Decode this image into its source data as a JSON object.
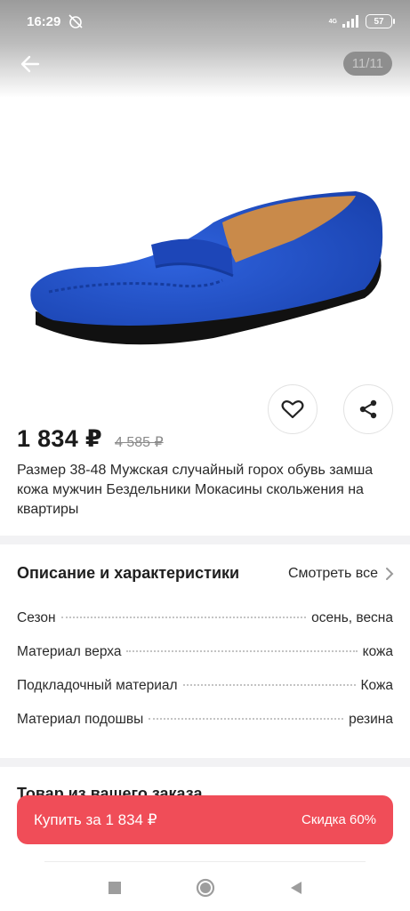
{
  "status_bar": {
    "time": "16:29",
    "network": "4G",
    "battery": "57"
  },
  "gallery": {
    "counter": "11/11"
  },
  "product": {
    "price": "1 834 ₽",
    "old_price": "4 585 ₽",
    "title": "Размер 38-48 Мужская случайный горох обувь замша кожа мужчин Бездельники Мокасины скольжения на квартиры"
  },
  "description": {
    "title": "Описание и характеристики",
    "see_all": "Смотреть все",
    "specs": [
      {
        "label": "Сезон",
        "value": "осень, весна"
      },
      {
        "label": "Материал верха",
        "value": "кожа"
      },
      {
        "label": "Подкладочный материал",
        "value": "Кожа"
      },
      {
        "label": "Материал подошвы",
        "value": "резина"
      }
    ]
  },
  "order_section": {
    "title": "Товар из вашего заказа"
  },
  "buy": {
    "label": "Купить за 1 834 ₽",
    "discount": "Скидка 60%"
  },
  "colors": {
    "accent": "#f04d58",
    "shoe": "#1f4fc4"
  },
  "icons": [
    "back-arrow-icon",
    "heart-icon",
    "share-icon",
    "chevron-right-icon",
    "nav-square-icon",
    "nav-circle-icon",
    "nav-triangle-icon"
  ]
}
